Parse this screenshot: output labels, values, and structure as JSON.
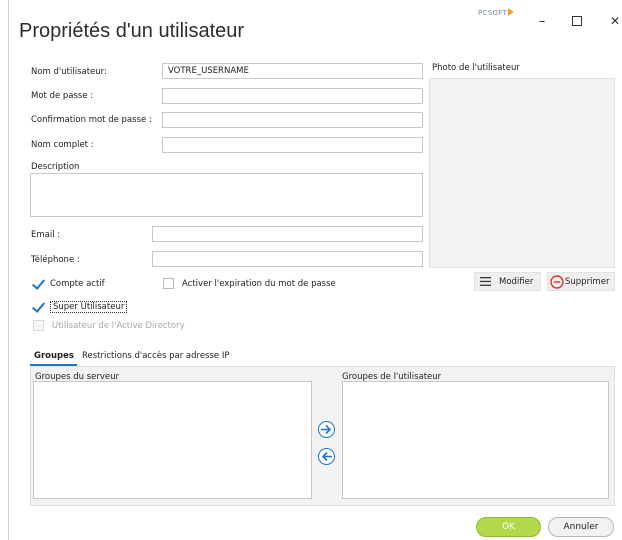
{
  "window": {
    "title": "Propriétés d'un utilisateur",
    "brand": "PCSOFT",
    "controls": {
      "minimize": "–",
      "close": "✕"
    }
  },
  "form": {
    "username": {
      "label": "Nom d'utilisateur:",
      "value": "VOTRE_USERNAME"
    },
    "password": {
      "label": "Mot de passe :",
      "value": ""
    },
    "password_confirm": {
      "label": "Confirmation mot de passe :",
      "value": ""
    },
    "fullname": {
      "label": "Nom complet :",
      "value": ""
    },
    "description": {
      "label": "Description",
      "value": ""
    },
    "email": {
      "label": "Email :",
      "value": ""
    },
    "phone": {
      "label": "Téléphone :",
      "value": ""
    }
  },
  "photo": {
    "label": "Photo de l'utilisateur",
    "modify_label": "Modifier",
    "delete_label": "Supprimer"
  },
  "options": {
    "active_account": {
      "label": "Compte actif",
      "checked": true
    },
    "password_expiration": {
      "label": "Activer l'expiration du mot de passe",
      "checked": false
    },
    "super_user": {
      "label": "Super Utilisateur",
      "checked": true
    },
    "active_directory": {
      "label": "Utilisateur de l'Active Directory",
      "checked": false,
      "disabled": true
    }
  },
  "tabs": [
    {
      "label": "Groupes",
      "active": true
    },
    {
      "label": "Restrictions d'accès par adresse IP",
      "active": false
    }
  ],
  "groups": {
    "server_groups_label": "Groupes du serveur",
    "user_groups_label": "Groupes de l'utilisateur"
  },
  "footer": {
    "ok_label": "OK",
    "cancel_label": "Annuler"
  },
  "colors": {
    "accent": "#1a78c8",
    "ok_button": "#b2d94a",
    "delete_icon": "#e03030"
  }
}
